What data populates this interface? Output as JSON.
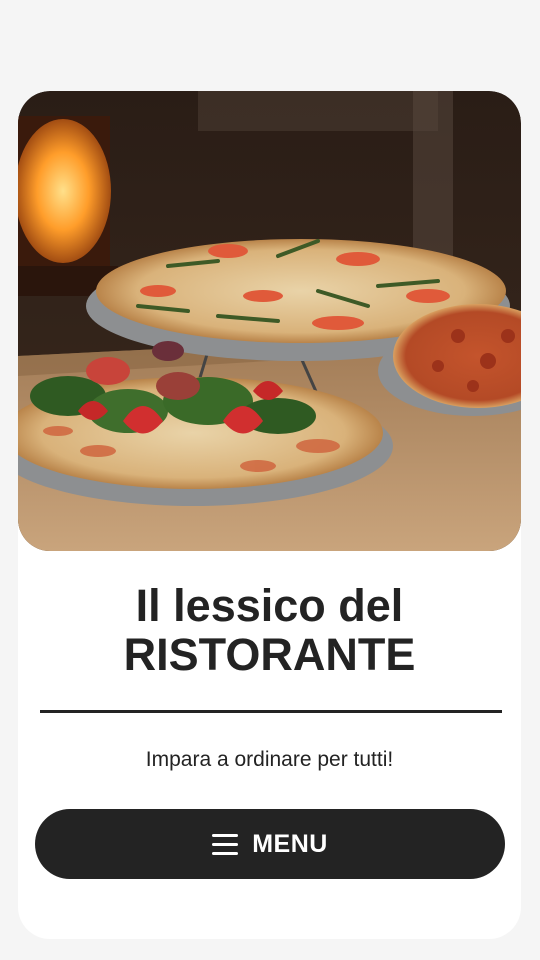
{
  "hero": {
    "image_description_icon": "pizza-photo"
  },
  "title": {
    "line1": "Il lessico del",
    "line2": "RISTORANTE"
  },
  "subtitle": "Impara a ordinare per tutti!",
  "menu_button": {
    "icon": "hamburger-icon",
    "label": "MENU"
  },
  "colors": {
    "page_bg": "#f5f5f5",
    "card_bg": "#ffffff",
    "text": "#232323",
    "button_bg": "#232323",
    "button_text": "#ffffff"
  }
}
